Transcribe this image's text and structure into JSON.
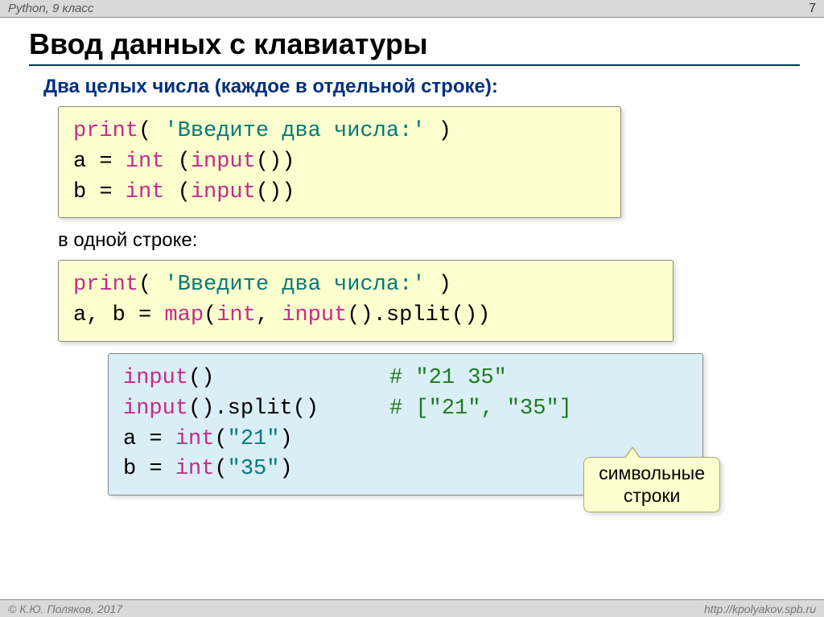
{
  "header": {
    "left": "Python, 9 класс",
    "page": "7"
  },
  "title": "Ввод данных с клавиатуры",
  "subtitle": "Два целых числа (каждое в отдельной строке):",
  "code1": {
    "t1": "print",
    "t2": "(",
    "t3": " 'Введите два числа:' ",
    "t4": ")",
    "t5": "a = ",
    "t6": "int ",
    "t7": "(",
    "t8": "input",
    "t9": "())",
    "t10": "b = ",
    "t11": "int ",
    "t12": "(",
    "t13": "input",
    "t14": "())"
  },
  "plain1": "в одной строке:",
  "code2": {
    "t1": "print",
    "t2": "(",
    "t3": " 'Введите два числа:' ",
    "t4": ")",
    "t5": "a, b = ",
    "t6": "map",
    "t7": "(",
    "t8": "int",
    "t9": ", ",
    "t10": "input",
    "t11": "().split())"
  },
  "code3": {
    "r1a": "input",
    "r1b": "()",
    "comment1": "# \"21 35\"",
    "r2a": "input",
    "r2b": "().split()",
    "comment2": "# [\"21\", \"35\"]",
    "r3a": "a = ",
    "r3b": "int",
    "r3c": "(",
    "r3d": "\"21\"",
    "r3e": ")",
    "r4a": "b = ",
    "r4b": "int",
    "r4c": "(",
    "r4d": "\"35\"",
    "r4e": ")"
  },
  "callout": {
    "line1": "символьные",
    "line2": "строки"
  },
  "footer": {
    "left": "© К.Ю. Поляков, 2017",
    "right": "http://kpolyakov.spb.ru"
  }
}
